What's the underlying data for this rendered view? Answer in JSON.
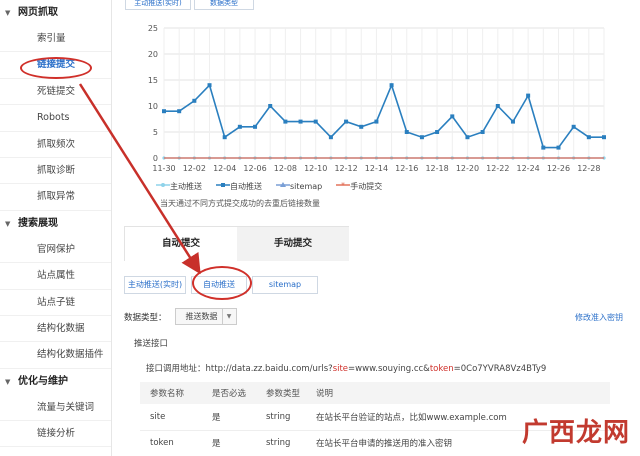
{
  "sidebar": {
    "sections": [
      {
        "title": "网页抓取",
        "items": [
          "索引量",
          "链接提交",
          "死链提交",
          "Robots",
          "抓取频次",
          "抓取诊断",
          "抓取异常"
        ]
      },
      {
        "title": "搜索展现",
        "items": [
          "官网保护",
          "站点属性",
          "站点子链",
          "结构化数据",
          "结构化数据插件"
        ]
      },
      {
        "title": "优化与维护",
        "items": [
          "流量与关键词",
          "链接分析"
        ]
      }
    ],
    "active_item": "链接提交"
  },
  "top_tabs": [
    "主动推送(实时)",
    "数据类型"
  ],
  "chart_data": {
    "type": "line",
    "x": [
      "11-30",
      "12-01",
      "12-02",
      "12-03",
      "12-04",
      "12-05",
      "12-06",
      "12-07",
      "12-08",
      "12-09",
      "12-10",
      "12-11",
      "12-12",
      "12-13",
      "12-14",
      "12-15",
      "12-16",
      "12-17",
      "12-18",
      "12-19",
      "12-20",
      "12-21",
      "12-22",
      "12-23",
      "12-24",
      "12-25",
      "12-26",
      "12-27",
      "12-28",
      "12-29"
    ],
    "xticks": [
      "11-30",
      "12-02",
      "12-04",
      "12-06",
      "12-08",
      "12-10",
      "12-12",
      "12-14",
      "12-16",
      "12-18",
      "12-20",
      "12-22",
      "12-24",
      "12-26",
      "12-28"
    ],
    "yticks": [
      0,
      5,
      10,
      15,
      20,
      25
    ],
    "ylim": [
      0,
      25
    ],
    "series": [
      {
        "name": "主动推送",
        "color": "#8fd3ea",
        "values": [
          0,
          0,
          0,
          0,
          0,
          0,
          0,
          0,
          0,
          0,
          0,
          0,
          0,
          0,
          0,
          0,
          0,
          0,
          0,
          0,
          0,
          0,
          0,
          0,
          0,
          0,
          0,
          0,
          0,
          0
        ]
      },
      {
        "name": "自动推送",
        "color": "#2a7fbf",
        "values": [
          9,
          9,
          11,
          14,
          4,
          6,
          6,
          10,
          7,
          7,
          7,
          4,
          7,
          6,
          7,
          14,
          5,
          4,
          5,
          8,
          4,
          5,
          10,
          7,
          12,
          2,
          2,
          6,
          4,
          4
        ]
      },
      {
        "name": "sitemap",
        "color": "#7a9fd6",
        "values": [
          0,
          0,
          0,
          0,
          0,
          0,
          0,
          0,
          0,
          0,
          0,
          0,
          0,
          0,
          0,
          0,
          0,
          0,
          0,
          0,
          0,
          0,
          0,
          0,
          0,
          0,
          0,
          0,
          0,
          0
        ]
      },
      {
        "name": "手动提交",
        "color": "#e2725b",
        "values": [
          0,
          0,
          0,
          0,
          0,
          0,
          0,
          0,
          0,
          0,
          0,
          0,
          0,
          0,
          0,
          0,
          0,
          0,
          0,
          0,
          0,
          0,
          0,
          0,
          0,
          0,
          0,
          0,
          0,
          0
        ]
      }
    ],
    "grid": true,
    "legend_position": "bottom-left"
  },
  "chart_note": "当天通过不同方式提交成功的去重后链接数量",
  "submit_tabs": [
    "自动提交",
    "手动提交"
  ],
  "push_tabs": [
    "主动推送(实时)",
    "自动推送",
    "sitemap"
  ],
  "data_type": {
    "label": "数据类型：",
    "value": "推送数据"
  },
  "modify_link": "修改准入密钥",
  "push_port_label": "推送接口",
  "api_url": {
    "label": "接口调用地址：",
    "prefix": "http://data.zz.baidu.com/urls?",
    "site_key": "site",
    "mid": "=www.souying.cc&",
    "token_key": "token",
    "suffix": "=0Co7YVRA8Vz4BTy9"
  },
  "param_table": {
    "headers": [
      "参数名称",
      "是否必选",
      "参数类型",
      "说明"
    ],
    "rows": [
      [
        "site",
        "是",
        "string",
        "在站长平台验证的站点，比如www.example.com"
      ],
      [
        "token",
        "是",
        "string",
        "在站长平台申请的推送用的准入密钥"
      ]
    ]
  },
  "watermark": "广西龙网"
}
